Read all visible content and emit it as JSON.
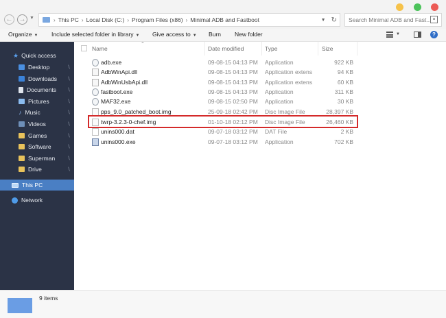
{
  "window": {
    "controls": {
      "minimize_color": "#f6c24a",
      "maximize_color": "#4cc35b",
      "close_color": "#ec5b55"
    }
  },
  "address": {
    "crumbs": [
      "This PC",
      "Local Disk (C:)",
      "Program Files (x86)",
      "Minimal ADB and Fastboot"
    ],
    "separator": "›"
  },
  "search": {
    "placeholder": "Search Minimal ADB and Fast..."
  },
  "toolbar": {
    "organize": "Organize",
    "include": "Include selected folder in library",
    "share": "Give access to",
    "burn": "Burn",
    "new_folder": "New folder"
  },
  "sidebar": {
    "quick_access": "Quick access",
    "items": [
      "Desktop",
      "Downloads",
      "Documents",
      "Pictures",
      "Music",
      "Videos",
      "Games",
      "Software",
      "Superman",
      "Drive"
    ],
    "this_pc": "This PC",
    "network": "Network"
  },
  "table": {
    "columns": {
      "name": "Name",
      "date": "Date modified",
      "type": "Type",
      "size": "Size"
    },
    "rows": [
      {
        "name": "adb.exe",
        "date": "09-08-15 04:13 PM",
        "type": "Application",
        "size": "922 KB",
        "icon": "exe-icon"
      },
      {
        "name": "AdbWinApi.dll",
        "date": "09-08-15 04:13 PM",
        "type": "Application extens",
        "size": "94 KB",
        "icon": "dll-icon"
      },
      {
        "name": "AdbWinUsbApi.dll",
        "date": "09-08-15 04:13 PM",
        "type": "Application extens",
        "size": "60 KB",
        "icon": "dll-icon"
      },
      {
        "name": "fastboot.exe",
        "date": "09-08-15 04:13 PM",
        "type": "Application",
        "size": "311 KB",
        "icon": "exe-icon"
      },
      {
        "name": "MAF32.exe",
        "date": "09-08-15 02:50 PM",
        "type": "Application",
        "size": "30 KB",
        "icon": "exe-icon"
      },
      {
        "name": "pps_9.0_patched_boot.img",
        "date": "25-09-18 02:42 PM",
        "type": "Disc Image File",
        "size": "28,397 KB",
        "icon": "disc-image-icon"
      },
      {
        "name": "twrp-3.2.3-0-chef.img",
        "date": "01-10-18 02:12 PM",
        "type": "Disc Image File",
        "size": "26,460 KB",
        "icon": "disc-image-icon"
      },
      {
        "name": "unins000.dat",
        "date": "09-07-18 03:12 PM",
        "type": "DAT File",
        "size": "2 KB",
        "icon": "dat-file-icon"
      },
      {
        "name": "unins000.exe",
        "date": "09-07-18 03:12 PM",
        "type": "Application",
        "size": "702 KB",
        "icon": "installer-icon"
      }
    ]
  },
  "status": {
    "count": "9 items"
  },
  "highlight": {
    "color": "#d42a2a"
  }
}
